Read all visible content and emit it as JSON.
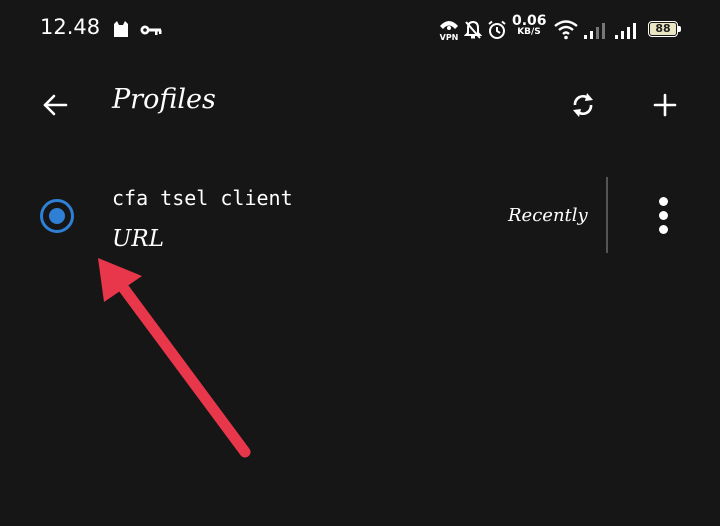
{
  "status_bar": {
    "time": "12.48",
    "net_speed_value": "0.06",
    "net_speed_unit": "KB/S",
    "battery_level": "88",
    "icons": [
      "cat-icon",
      "key-icon",
      "vpn-icon",
      "mute-icon",
      "alarm-icon",
      "wifi-icon",
      "signal-icon",
      "signal-icon",
      "battery-icon"
    ]
  },
  "appbar": {
    "title": "Profiles",
    "icons": [
      "back-arrow-icon",
      "sync-icon",
      "add-icon"
    ]
  },
  "profiles": [
    {
      "name": "cfa tsel client",
      "type": "URL",
      "updated": "Recently",
      "selected": true
    }
  ],
  "colors": {
    "background": "#161616",
    "accent": "#2f80d4",
    "annotation_arrow": "#e8374a"
  }
}
